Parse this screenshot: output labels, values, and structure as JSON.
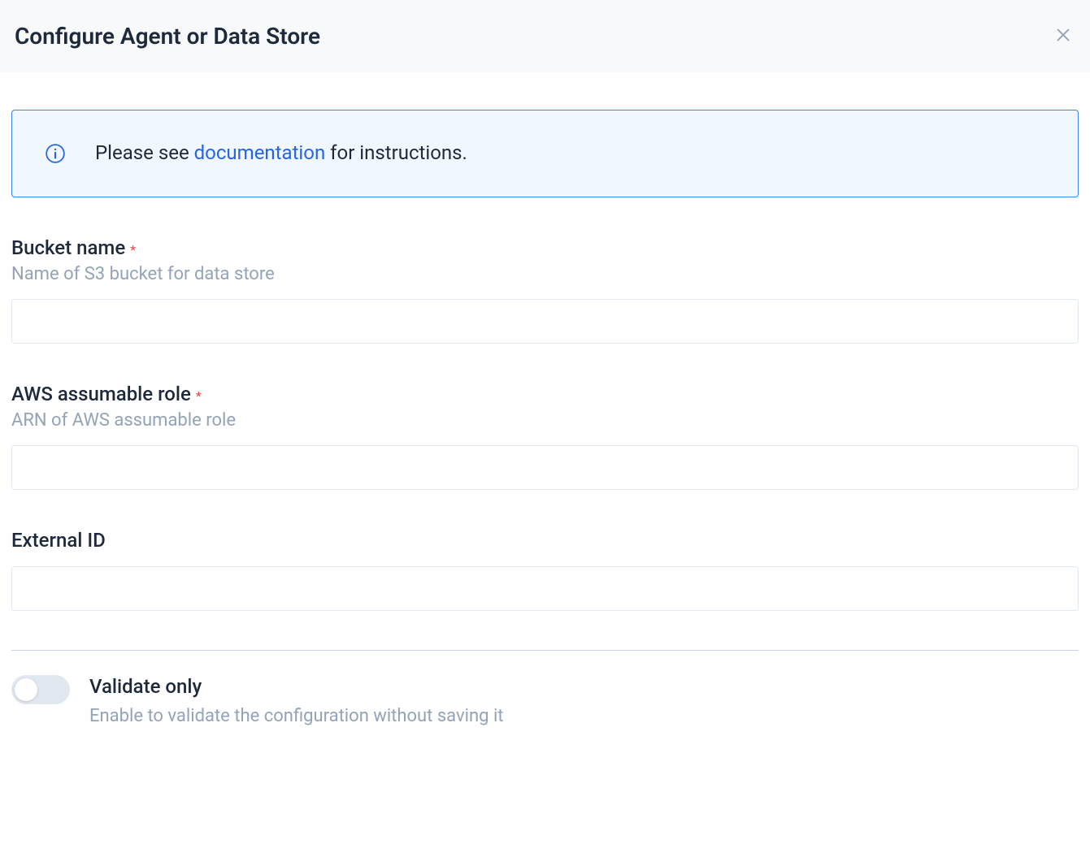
{
  "header": {
    "title": "Configure Agent or Data Store"
  },
  "banner": {
    "prefix": "Please see ",
    "linkText": "documentation",
    "suffix": " for instructions."
  },
  "fields": {
    "bucket": {
      "label": "Bucket name",
      "required": "*",
      "help": "Name of S3 bucket for data store",
      "value": ""
    },
    "role": {
      "label": "AWS assumable role",
      "required": "*",
      "help": "ARN of AWS assumable role",
      "value": ""
    },
    "externalId": {
      "label": "External ID",
      "value": ""
    }
  },
  "toggle": {
    "label": "Validate only",
    "help": "Enable to validate the configuration without saving it",
    "enabled": false
  }
}
